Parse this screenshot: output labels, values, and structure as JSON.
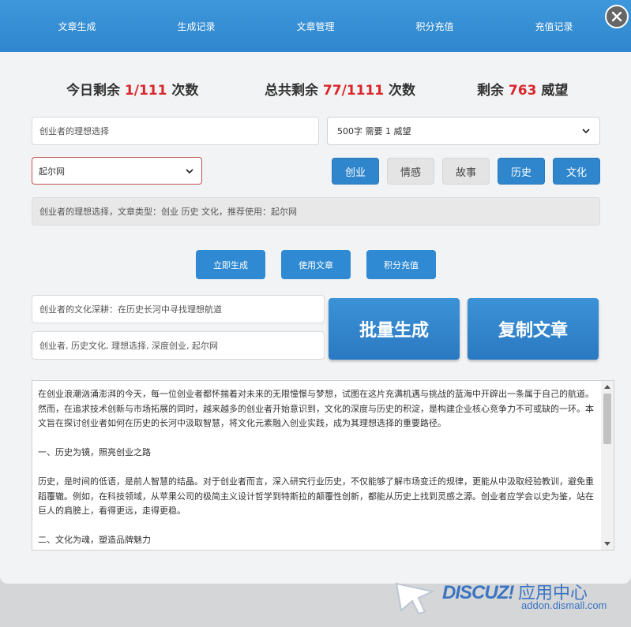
{
  "nav": {
    "items": [
      "文章生成",
      "生成记录",
      "文章管理",
      "积分充值",
      "充值记录"
    ]
  },
  "stats": {
    "today_prefix": "今日剩余",
    "today_value": "1/111",
    "today_suffix": "次数",
    "total_prefix": "总共剩余",
    "total_value": "77/1111",
    "total_suffix": "次数",
    "remain_prefix": "剩余",
    "remain_value": "763",
    "remain_suffix": "威望"
  },
  "topic_input": {
    "value": "创业者的理想选择"
  },
  "length_select": {
    "value": "500字 需要 1 威望"
  },
  "site_select": {
    "value": "起尔网"
  },
  "tags": [
    {
      "label": "创业",
      "active": true
    },
    {
      "label": "情感",
      "active": false
    },
    {
      "label": "故事",
      "active": false
    },
    {
      "label": "历史",
      "active": true
    },
    {
      "label": "文化",
      "active": true
    }
  ],
  "summary": {
    "text": "创业者的理想选择，文章类型：创业 历史 文化，推荐使用：起尔网"
  },
  "actions": {
    "generate": "立即生成",
    "use": "使用文章",
    "recharge": "积分充值"
  },
  "title_field": {
    "value": "创业者的文化深耕：在历史长河中寻找理想航道"
  },
  "keywords_field": {
    "value": "创业者, 历史文化, 理想选择, 深度创业, 起尔网"
  },
  "big_buttons": {
    "batch": "批量生成",
    "copy": "复制文章"
  },
  "article": {
    "paragraphs": [
      "在创业浪潮汹涌澎湃的今天，每一位创业者都怀揣着对未来的无限憧憬与梦想，试图在这片充满机遇与挑战的蓝海中开辟出一条属于自己的航道。然而，在追求技术创新与市场拓展的同时，越来越多的创业者开始意识到，文化的深度与历史的积淀，是构建企业核心竞争力不可或缺的一环。本文旨在探讨创业者如何在历史的长河中汲取智慧，将文化元素融入创业实践，成为其理想选择的重要路径。",
      "一、历史为镜，照亮创业之路",
      "历史，是时间的低语，是前人智慧的结晶。对于创业者而言，深入研究行业历史，不仅能够了解市场变迁的规律，更能从中汲取经验教训，避免重蹈覆辙。例如，在科技领域，从苹果公司的极简主义设计哲学到特斯拉的颠覆性创新，都能从历史上找到灵感之源。创业者应学会以史为鉴，站在巨人的肩膀上，看得更远，走得更稳。",
      "二、文化为魂，塑造品牌魅力"
    ]
  },
  "watermark": {
    "logo": "DISCUZ!",
    "logo_cn": "应用中心",
    "url": "addon.dismall.com"
  },
  "colors": {
    "primary": "#2f86cd",
    "accent_number": "#d9262c"
  }
}
